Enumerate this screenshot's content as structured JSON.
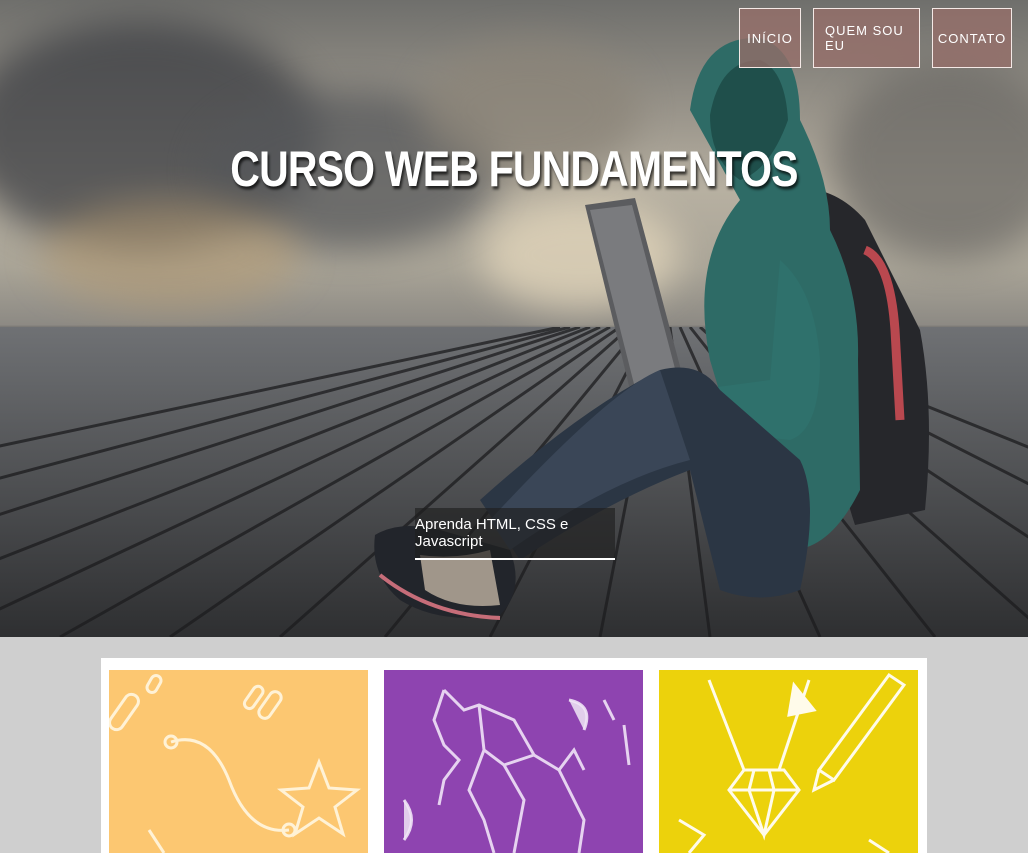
{
  "nav": {
    "items": [
      {
        "label": "INÍCIO"
      },
      {
        "label": "QUEM SOU EU"
      },
      {
        "label": "CONTATO"
      }
    ]
  },
  "hero": {
    "title": "CURSO WEB FUNDAMENTOS",
    "subtitle": "Aprenda HTML, CSS e Javascript"
  },
  "cards": [
    {
      "icon": "yellow-orange-doodle-card",
      "color": "#fcc771"
    },
    {
      "icon": "purple-elephant-card",
      "color": "#8e44b0"
    },
    {
      "icon": "yellow-gem-pencil-card",
      "color": "#ecd20c"
    }
  ]
}
